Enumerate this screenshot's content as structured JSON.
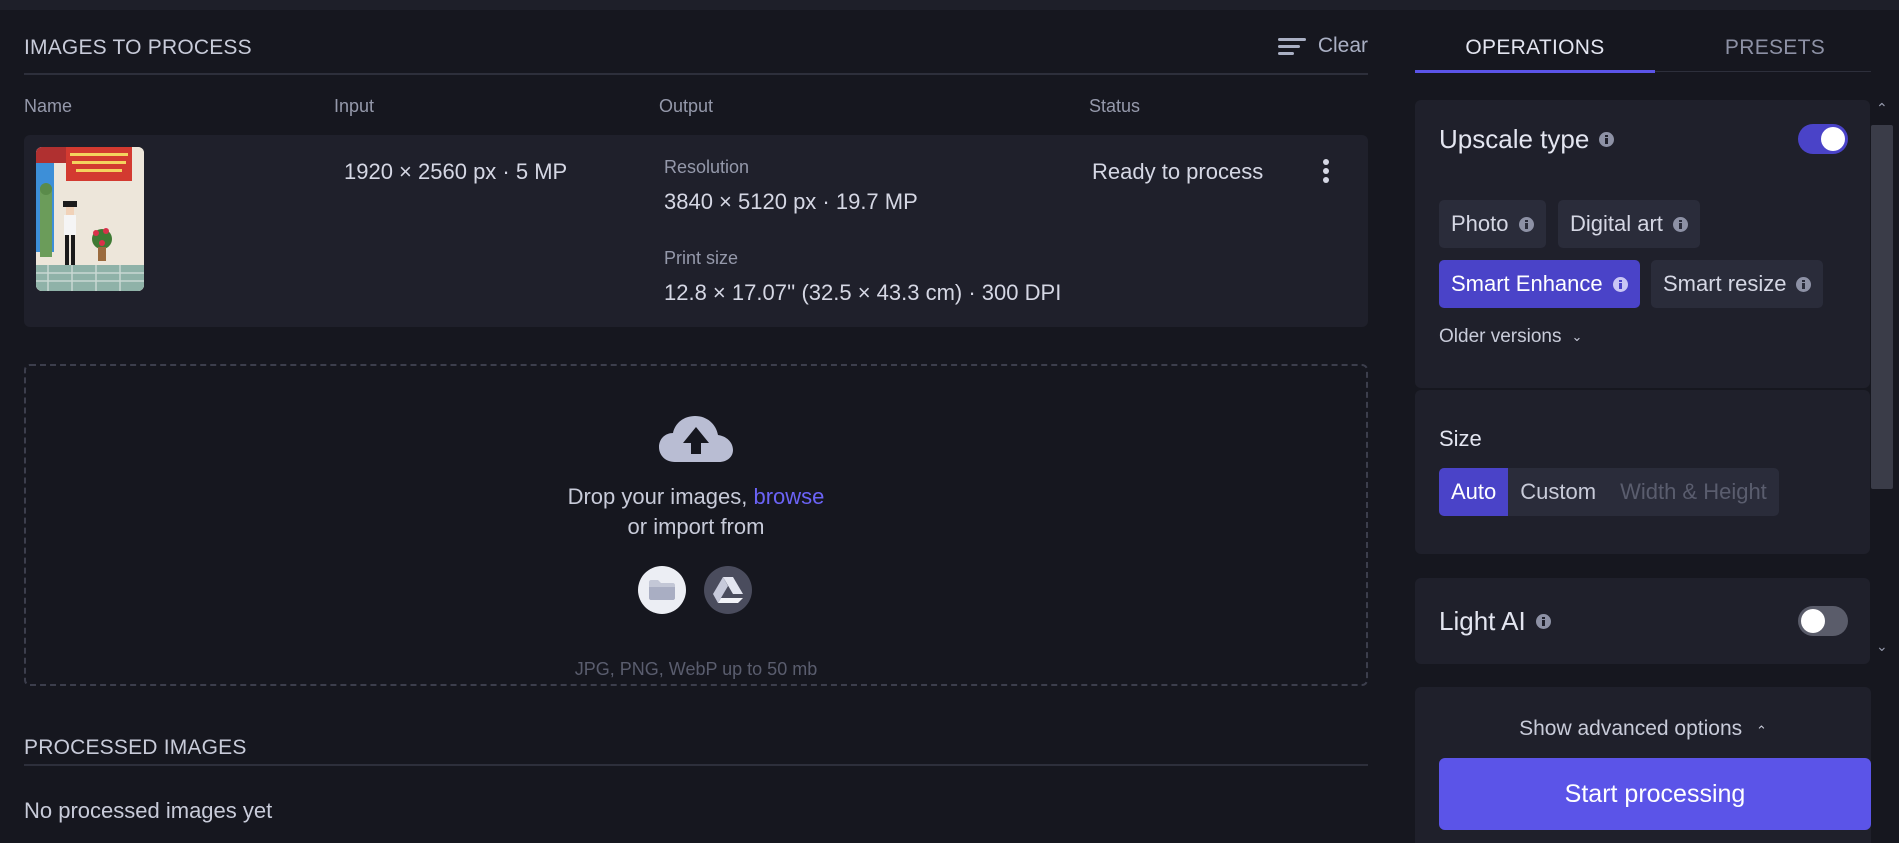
{
  "queue": {
    "title": "IMAGES TO PROCESS",
    "clear_label": "Clear",
    "columns": [
      "Name",
      "Input",
      "Output",
      "Status"
    ],
    "items": [
      {
        "input": "1920 × 2560 px · 5 MP",
        "resolution_label": "Resolution",
        "resolution": "3840 × 5120 px · 19.7 MP",
        "print_label": "Print size",
        "print_size": "12.8 × 17.07'' (32.5 × 43.3 cm) · 300 DPI",
        "status": "Ready to process"
      }
    ]
  },
  "dropzone": {
    "text": "Drop your images,",
    "browse": "browse",
    "import_text": "or import from",
    "hint": "JPG, PNG, WebP up to 50 mb",
    "icons": [
      "cloud-upload-icon",
      "folder-icon",
      "google-drive-icon"
    ]
  },
  "processed": {
    "title": "PROCESSED IMAGES",
    "empty": "No processed images yet"
  },
  "tabs": {
    "operations": "OPERATIONS",
    "presets": "PRESETS",
    "active": "OPERATIONS"
  },
  "upscale": {
    "title": "Upscale type",
    "enabled": true,
    "types": [
      "Photo",
      "Digital art",
      "Smart Enhance",
      "Smart resize"
    ],
    "selected": "Smart Enhance",
    "older_versions": "Older versions"
  },
  "size": {
    "title": "Size",
    "options": [
      "Auto",
      "Custom",
      "Width & Height"
    ],
    "selected": "Auto"
  },
  "light_ai": {
    "title": "Light AI",
    "enabled": false
  },
  "footer": {
    "advanced": "Show advanced options",
    "start": "Start processing"
  },
  "colors": {
    "accent": "#5b54e8",
    "background": "#16171f",
    "panel": "#1f202b"
  }
}
